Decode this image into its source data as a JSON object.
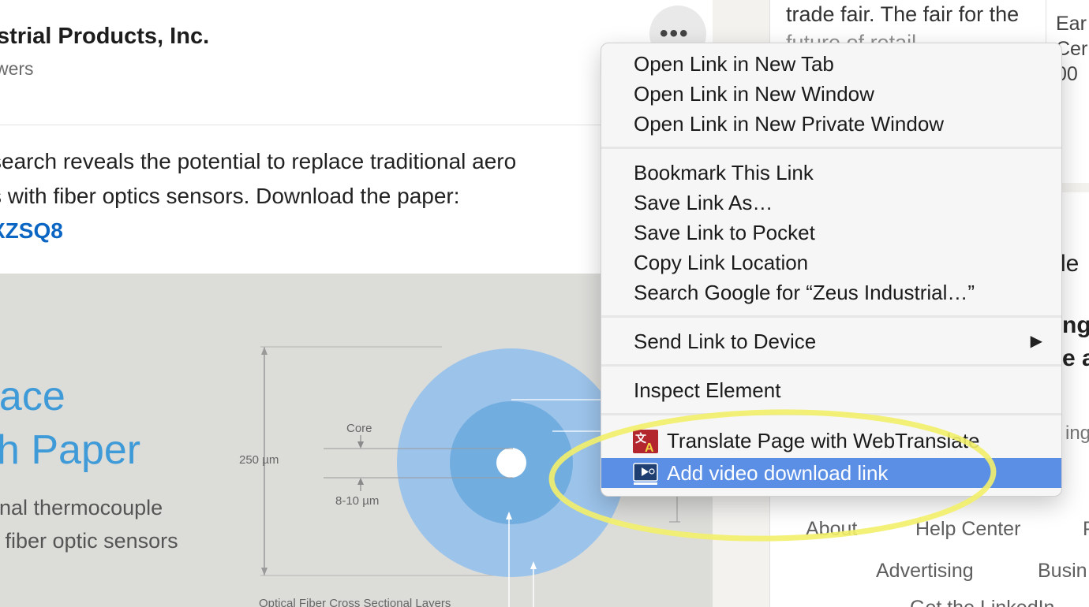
{
  "post": {
    "company_name": "strial Products, Inc.",
    "followers_text": "wers",
    "more_button_label": "•••",
    "text_line1": "search reveals the potential to replace traditional aero",
    "text_line2": "s with fiber optics sensors. Download the paper:",
    "link_text": "XZSQ8"
  },
  "image": {
    "title_line1": "pace",
    "title_line2": "ch Paper",
    "subtitle_line1": "onal thermocouple",
    "subtitle_line2": "n fiber optic sensors",
    "diagram": {
      "label_core": "Core",
      "label_250": "250 µm",
      "label_810": "8-10 µm",
      "caption": "Optical Fiber Cross Sectional Layers"
    }
  },
  "sidebar": {
    "ad_line1": "trade fair. The fair for the",
    "ad_line2": "future of retail",
    "ad2_line1": "Ear",
    "ad2_line2": "Cer",
    "ad2_line3": "00",
    "frag_le": "le",
    "frag_ng": "ng",
    "frag_ea": "e ar",
    "frag_ing": "ing"
  },
  "footer": {
    "about": "About",
    "help_center": "Help Center",
    "p_cut": "P",
    "advertising": "Advertising",
    "business_cut": "Busin",
    "get_app_cut": "Get the LinkedIn"
  },
  "context_menu": {
    "open_new_tab": "Open Link in New Tab",
    "open_new_window": "Open Link in New Window",
    "open_private_window": "Open Link in New Private Window",
    "bookmark_link": "Bookmark This Link",
    "save_link_as": "Save Link As…",
    "save_to_pocket": "Save Link to Pocket",
    "copy_link_location": "Copy Link Location",
    "search_google": "Search Google for “Zeus Industrial…”",
    "send_to_device": "Send Link to Device",
    "submenu_arrow": "▶",
    "inspect_element": "Inspect Element",
    "translate_page": "Translate Page with WebTranslate",
    "add_video_download": "Add video download link"
  },
  "colors": {
    "highlight": "#5b8fe6",
    "link": "#0a66c2",
    "annotation": "#f3f06a",
    "diagram_blue_outer": "#9cc3ea",
    "diagram_blue_inner": "#72ade0"
  }
}
